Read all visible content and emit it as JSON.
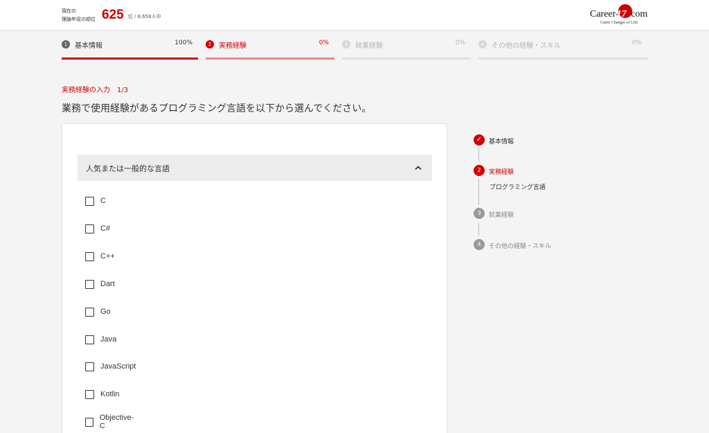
{
  "header": {
    "rank_label_1": "現在の",
    "rank_label_2": "理論年収の順位",
    "rank_value": "625",
    "rank_suffix": "位 / 8,658人中",
    "logo_text": "Career-",
    "logo_mark_text": "17",
    "logo_text_tail": ".com",
    "logo_sub": "Game Changer of Life"
  },
  "progress_steps": [
    {
      "num": "1",
      "label": "基本情報",
      "percent": "100%",
      "fill": 1.0,
      "state": "done"
    },
    {
      "num": "2",
      "label": "実務経験",
      "percent": "0%",
      "fill": 1.0,
      "state": "active"
    },
    {
      "num": "3",
      "label": "就業経験",
      "percent": "0%",
      "fill": 0,
      "state": "pending"
    },
    {
      "num": "4",
      "label": "その他の経験・スキル",
      "percent": "0%",
      "fill": 0,
      "state": "pending"
    }
  ],
  "main": {
    "section_sub": "実務経験の入力　1/3",
    "question": "業務で使用経験があるプログラミング言語を以下から選んでください。",
    "accordion_title": "人気または一般的な言語",
    "languages": [
      "C",
      "C#",
      "C++",
      "Dart",
      "Go",
      "Java",
      "JavaScript",
      "Kotlin",
      "Objective-C"
    ]
  },
  "sidebar": {
    "items": [
      {
        "num": "✓",
        "label": "基本情報",
        "state": "done"
      },
      {
        "num": "2",
        "label": "実務経験",
        "state": "active",
        "sublabel": "プログラミング言語"
      },
      {
        "num": "3",
        "label": "就業経験",
        "state": "pending"
      },
      {
        "num": "4",
        "label": "その他の経験・スキル",
        "state": "pending"
      }
    ]
  },
  "colors": {
    "accent": "#d10000",
    "accent_light": "#ef8a8a",
    "pending": "#c8c8c8",
    "pending_text": "#b5b5b5"
  }
}
